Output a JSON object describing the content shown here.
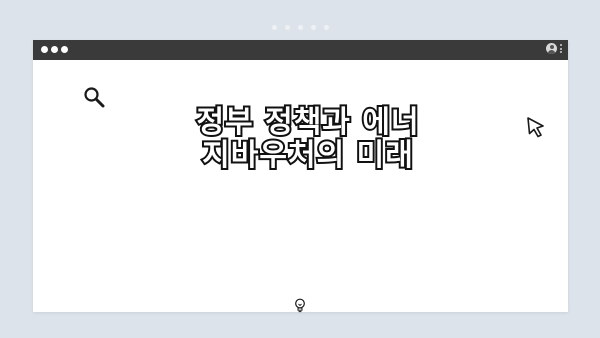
{
  "window": {
    "controls": [
      "close",
      "minimize",
      "maximize"
    ],
    "right_icons": [
      "user-icon",
      "menu-dots-icon"
    ]
  },
  "content": {
    "headline": "정부 정책과 에너지바우처의 미래",
    "icons": [
      "search-icon",
      "cursor-arrow-icon",
      "lightbulb-icon"
    ]
  },
  "colors": {
    "background": "#dde3ea",
    "titlebar": "#3a3a3a",
    "window": "#ffffff",
    "headline_stroke": "#111111"
  }
}
